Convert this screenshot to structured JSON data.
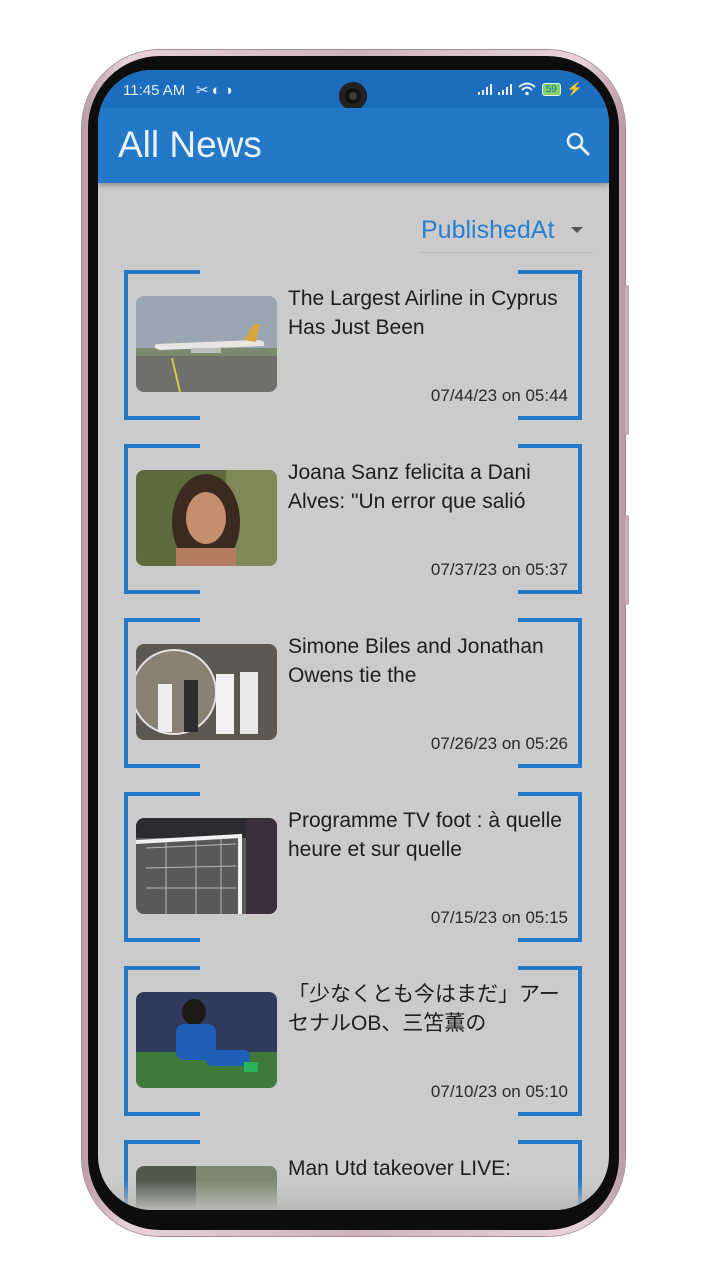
{
  "status_bar": {
    "time": "11:45 AM",
    "battery": "59"
  },
  "app_bar": {
    "title": "All News",
    "search_icon": "search-icon"
  },
  "sort": {
    "selected": "PublishedAt"
  },
  "news": [
    {
      "title": "The Largest Airline in Cyprus Has Just Been",
      "date": "07/44/23 on 05:44"
    },
    {
      "title": "Joana Sanz felicita a Dani Alves: \"Un error que salió",
      "date": "07/37/23 on 05:37"
    },
    {
      "title": "Simone Biles and Jonathan Owens tie the",
      "date": "07/26/23 on 05:26"
    },
    {
      "title": "Programme TV foot : à quelle heure et sur quelle",
      "date": "07/15/23 on 05:15"
    },
    {
      "title": "「少なくとも今はまだ」アーセナルOB、三笘薫の",
      "date": "07/10/23 on 05:10"
    },
    {
      "title": "Man Utd takeover LIVE:",
      "date": ""
    }
  ],
  "colors": {
    "accent": "#2378c8",
    "status_bar": "#1c6dbd",
    "background": "#cbcbcb"
  }
}
